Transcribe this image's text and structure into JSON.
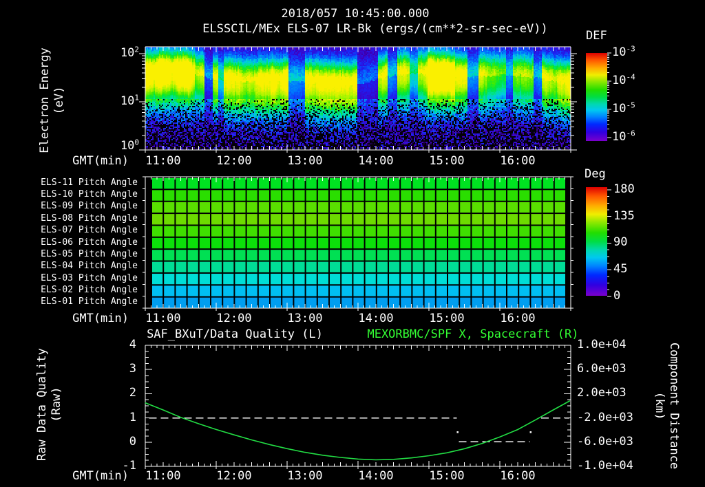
{
  "window": {
    "background": "#000000",
    "text_color": "#ffffff",
    "accent_green": "#33ff33"
  },
  "header": {
    "datetime": "2018/057 10:45:00.000",
    "instrument_title": "ELSSCIL/MEx ELS-07 LR-Bk  (ergs/(cm**2-sr-sec-eV))"
  },
  "time_axis": {
    "label": "GMT(min)",
    "tick_labels": [
      "11:00",
      "12:00",
      "13:00",
      "14:00",
      "15:00",
      "16:00"
    ],
    "start_hour": 10.75,
    "end_hour": 16.75
  },
  "spectrogram_panel": {
    "ylabel_line1": "Electron Energy",
    "ylabel_line2": "(eV)",
    "ytick_exponents": [
      "2",
      "1",
      "0"
    ],
    "colorbar_title": "DEF",
    "colorbar_exponents": [
      "-3",
      "-4",
      "-5",
      "-6"
    ]
  },
  "pitch_panel": {
    "colorbar_title": "Deg",
    "colorbar_ticks": [
      "180",
      "135",
      "90",
      "45",
      "0"
    ]
  },
  "quality_panel": {
    "title_left": "SAF_BXuT/Data Quality (L)",
    "title_right": "MEXORBMC/SPF X, Spacecraft (R)",
    "ylabel_left_line1": "Raw Data Quality",
    "ylabel_left_line2": "(Raw)",
    "ylabel_right_line1": "Component Distance",
    "ylabel_right_line2": "(km)",
    "yticks_left": [
      "4",
      "3",
      "2",
      "1",
      "0",
      "-1"
    ],
    "yticks_right": [
      "1.0e+04",
      "6.0e+03",
      "2.0e+03",
      "-2.0e+03",
      "-6.0e+03",
      "-1.0e+04"
    ]
  },
  "chart_data": [
    {
      "type": "heatmap",
      "name": "electron_energy_spectrogram",
      "title": "ELSSCIL/MEx ELS-07 LR-Bk (ergs/(cm**2-sr-sec-eV))",
      "xlabel": "GMT(min)",
      "x_ticks": [
        "11:00",
        "12:00",
        "13:00",
        "14:00",
        "15:00",
        "16:00"
      ],
      "x_range_gmt": [
        "10:45",
        "16:45"
      ],
      "ylabel": "Electron Energy (eV)",
      "y_scale": "log",
      "y_range_ev": [
        1,
        140
      ],
      "y_ticks_ev": [
        1,
        10,
        100
      ],
      "colorbar": {
        "title": "DEF",
        "units": "ergs/(cm**2-sr-sec-eV)",
        "scale": "log",
        "range": [
          1e-06,
          0.001
        ],
        "ticks": [
          "10^-3",
          "10^-4",
          "10^-5",
          "10^-6"
        ]
      },
      "description": "Bright green/yellow electron flux band centered near 20-50 eV across the whole interval, with dark vertical dropouts; purple-blue noise and black dropouts below ~8 eV; brightest patches before 11:30 and near 15:00.",
      "band_center_ev": 30,
      "flux_modulation": {
        "dips": [
          [
            0.138,
            0.158,
            0.3
          ],
          [
            0.17,
            0.183,
            0.45
          ],
          [
            0.333,
            0.375,
            0.35
          ],
          [
            0.497,
            0.545,
            0.22
          ],
          [
            0.568,
            0.592,
            0.35
          ],
          [
            0.62,
            0.64,
            0.55
          ],
          [
            0.757,
            0.782,
            0.35
          ],
          [
            0.845,
            0.862,
            0.45
          ],
          [
            0.912,
            0.93,
            0.4
          ]
        ],
        "brights": [
          [
            0.0,
            0.115,
            1.3
          ],
          [
            0.292,
            0.335,
            1.12
          ],
          [
            0.662,
            0.728,
            1.4
          ],
          [
            0.965,
            1.0,
            1.15
          ]
        ]
      }
    },
    {
      "type": "heatmap",
      "name": "pitch_angle_panels",
      "x_ticks": [
        "11:00",
        "12:00",
        "13:00",
        "14:00",
        "15:00",
        "16:00"
      ],
      "grid_minutes": 10,
      "colorbar": {
        "title": "Deg",
        "range": [
          0,
          180
        ],
        "ticks": [
          180,
          135,
          90,
          45,
          0
        ]
      },
      "rows": [
        {
          "label": "ELS-11 Pitch Angle",
          "mean_deg": 95,
          "color": "#00e321"
        },
        {
          "label": "ELS-10 Pitch Angle",
          "mean_deg": 103,
          "color": "#2ade00"
        },
        {
          "label": "ELS-09 Pitch Angle",
          "mean_deg": 110,
          "color": "#59df00"
        },
        {
          "label": "ELS-08 Pitch Angle",
          "mean_deg": 113,
          "color": "#6ddb00"
        },
        {
          "label": "ELS-07 Pitch Angle",
          "mean_deg": 105,
          "color": "#3fdf00"
        },
        {
          "label": "ELS-06 Pitch Angle",
          "mean_deg": 96,
          "color": "#0ce00a"
        },
        {
          "label": "ELS-05 Pitch Angle",
          "mean_deg": 88,
          "color": "#00e053"
        },
        {
          "label": "ELS-04 Pitch Angle",
          "mean_deg": 80,
          "color": "#00dd96"
        },
        {
          "label": "ELS-03 Pitch Angle",
          "mean_deg": 72,
          "color": "#00ddd6"
        },
        {
          "label": "ELS-02 Pitch Angle",
          "mean_deg": 62,
          "color": "#00bff2"
        },
        {
          "label": "ELS-01 Pitch Angle",
          "mean_deg": 56,
          "color": "#009ef0"
        }
      ]
    },
    {
      "type": "line",
      "name": "data_quality_and_spacecraft_distance",
      "title_left": "SAF_BXuT/Data Quality (L)",
      "title_right": "MEXORBMC/SPF X, Spacecraft (R)",
      "y_left": {
        "label": "Raw Data Quality (Raw)",
        "range": [
          -1,
          4
        ],
        "ticks": [
          4,
          3,
          2,
          1,
          0,
          -1
        ]
      },
      "y_right": {
        "label": "Component Distance (km)",
        "range": [
          -10000,
          10000
        ],
        "ticks": [
          "1.0e+04",
          "6.0e+03",
          "2.0e+03",
          "-2.0e+03",
          "-6.0e+03",
          "-1.0e+04"
        ]
      },
      "series": [
        {
          "name": "SAF_BXuT/Data Quality (L)",
          "axis": "left",
          "style": "dashed",
          "color": "#ffffff",
          "segments": [
            {
              "y": 1.0,
              "t_start": 10.8,
              "t_end": 15.14
            },
            {
              "y": 0.02,
              "t_start": 15.17,
              "t_end": 16.17
            },
            {
              "y": 1.0,
              "t_start": 16.33,
              "t_end": 16.73
            }
          ],
          "isolated_points": [
            {
              "t": 15.15,
              "y": 0.42
            },
            {
              "t": 16.18,
              "y": 0.42
            }
          ]
        },
        {
          "name": "MEXORBMC/SPF X, Spacecraft (R)",
          "axis": "right",
          "color": "#22dd44",
          "km_formula": "km = 4000*raw - 6000",
          "points_raw": [
            [
              10.75,
              1.62
            ],
            [
              11.0,
              1.33
            ],
            [
              11.25,
              1.02
            ],
            [
              11.5,
              0.76
            ],
            [
              11.75,
              0.52
            ],
            [
              12.0,
              0.3
            ],
            [
              12.25,
              0.09
            ],
            [
              12.5,
              -0.1
            ],
            [
              12.75,
              -0.27
            ],
            [
              13.0,
              -0.42
            ],
            [
              13.25,
              -0.54
            ],
            [
              13.5,
              -0.63
            ],
            [
              13.75,
              -0.7
            ],
            [
              14.0,
              -0.73
            ],
            [
              14.25,
              -0.71
            ],
            [
              14.5,
              -0.65
            ],
            [
              14.75,
              -0.56
            ],
            [
              15.0,
              -0.44
            ],
            [
              15.25,
              -0.27
            ],
            [
              15.5,
              -0.05
            ],
            [
              15.75,
              0.22
            ],
            [
              16.0,
              0.52
            ],
            [
              16.25,
              0.92
            ],
            [
              16.5,
              1.33
            ],
            [
              16.73,
              1.7
            ]
          ]
        }
      ]
    }
  ]
}
